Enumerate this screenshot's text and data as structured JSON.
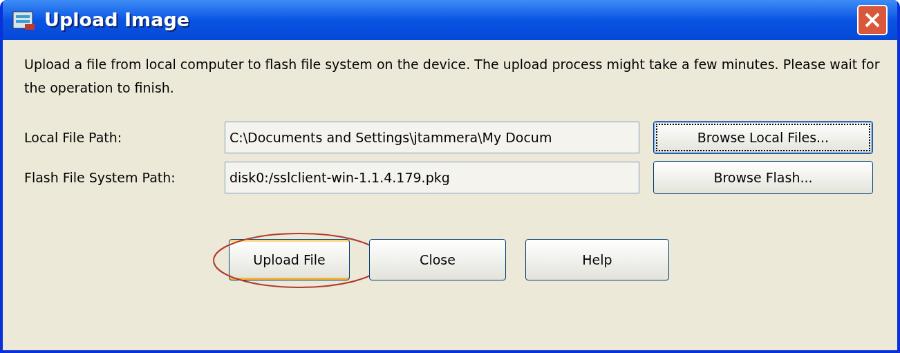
{
  "window": {
    "title": "Upload Image"
  },
  "description": "Upload a file from local computer to flash file system on the device. The upload process might take a few minutes. Please wait for the operation to finish.",
  "fields": [
    {
      "label": "Local File Path:",
      "value": "C:\\Documents and Settings\\jtammera\\My Docum",
      "button": {
        "label": "Browse Local Files...",
        "focused": true
      }
    },
    {
      "label": "Flash File System Path:",
      "value": "disk0:/sslclient-win-1.1.4.179.pkg",
      "button": {
        "label": "Browse Flash...",
        "focused": false
      }
    }
  ],
  "buttons": [
    {
      "label": "Upload File",
      "highlighted": true
    },
    {
      "label": "Close",
      "highlighted": false
    },
    {
      "label": "Help",
      "highlighted": false
    }
  ]
}
